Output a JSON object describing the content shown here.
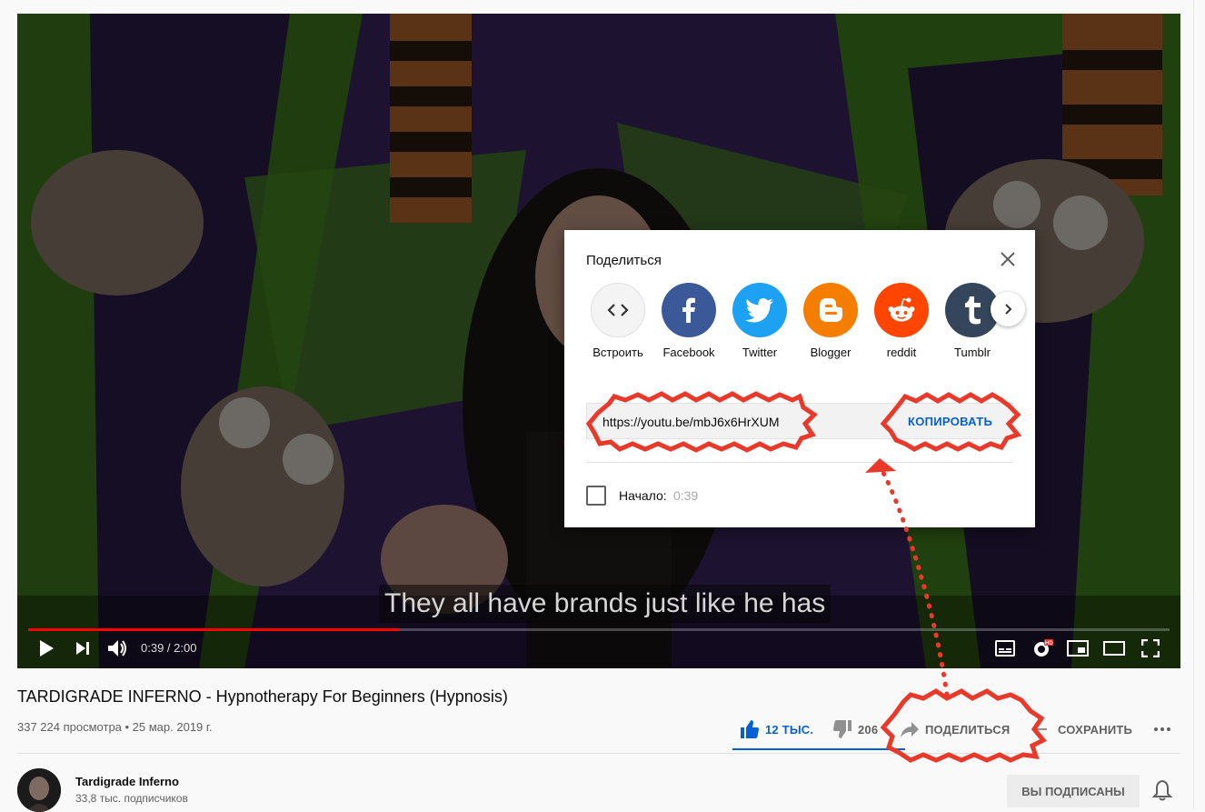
{
  "player": {
    "caption": "They all have brands just like he has",
    "time": "0:39 / 2:00",
    "progress_fraction": 0.325
  },
  "video": {
    "title": "TARDIGRADE INFERNO - Hypnotherapy For Beginners (Hypnosis)",
    "meta": "337 224 просмотра • 25 мар. 2019 г.",
    "likes": "12 ТЫС.",
    "dislikes": "206",
    "share_label": "ПОДЕЛИТЬСЯ",
    "save_label": "СОХРАНИТЬ",
    "like_ratio": 1.0
  },
  "channel": {
    "name": "Tardigrade Inferno",
    "subscribers": "33,8 тыс. подписчиков",
    "subscribed_label": "ВЫ ПОДПИСАНЫ"
  },
  "share_dialog": {
    "title": "Поделиться",
    "targets": [
      {
        "label": "Встроить",
        "icon": "embed-icon",
        "color": "#f4f4f4"
      },
      {
        "label": "Facebook",
        "icon": "facebook-icon",
        "color": "#3b5998"
      },
      {
        "label": "Twitter",
        "icon": "twitter-icon",
        "color": "#1da1f2"
      },
      {
        "label": "Blogger",
        "icon": "blogger-icon",
        "color": "#f57d00"
      },
      {
        "label": "reddit",
        "icon": "reddit-icon",
        "color": "#ff4500"
      },
      {
        "label": "Tumblr",
        "icon": "tumblr-icon",
        "color": "#35465c"
      }
    ],
    "url": "https://youtu.be/mbJ6x6HrXUM",
    "copy_label": "КОПИРОВАТЬ",
    "start_label": "Начало:",
    "start_time": "0:39"
  },
  "colors": {
    "accent_blue": "#065fd4",
    "progress_red": "#ff0000",
    "annotation_red": "#e8392b"
  }
}
